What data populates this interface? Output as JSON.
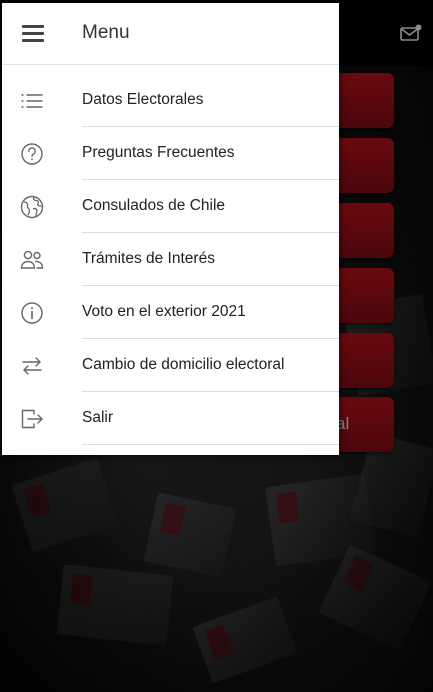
{
  "drawer": {
    "title": "Menu",
    "items": [
      {
        "label": "Datos Electorales",
        "icon": "list-icon"
      },
      {
        "label": "Preguntas Frecuentes",
        "icon": "question-icon"
      },
      {
        "label": "Consulados de Chile",
        "icon": "globe-icon"
      },
      {
        "label": "Trámites de Interés",
        "icon": "people-icon"
      },
      {
        "label": "Voto en el exterior 2021",
        "icon": "info-icon"
      },
      {
        "label": "Cambio de domicilio electoral",
        "icon": "swap-arrows-icon"
      },
      {
        "label": "Salir",
        "icon": "logout-icon"
      }
    ]
  },
  "background": {
    "partial_button_text": "al",
    "accent_color": "#b0101a",
    "app_bar_icon": "mail-notification-icon"
  }
}
